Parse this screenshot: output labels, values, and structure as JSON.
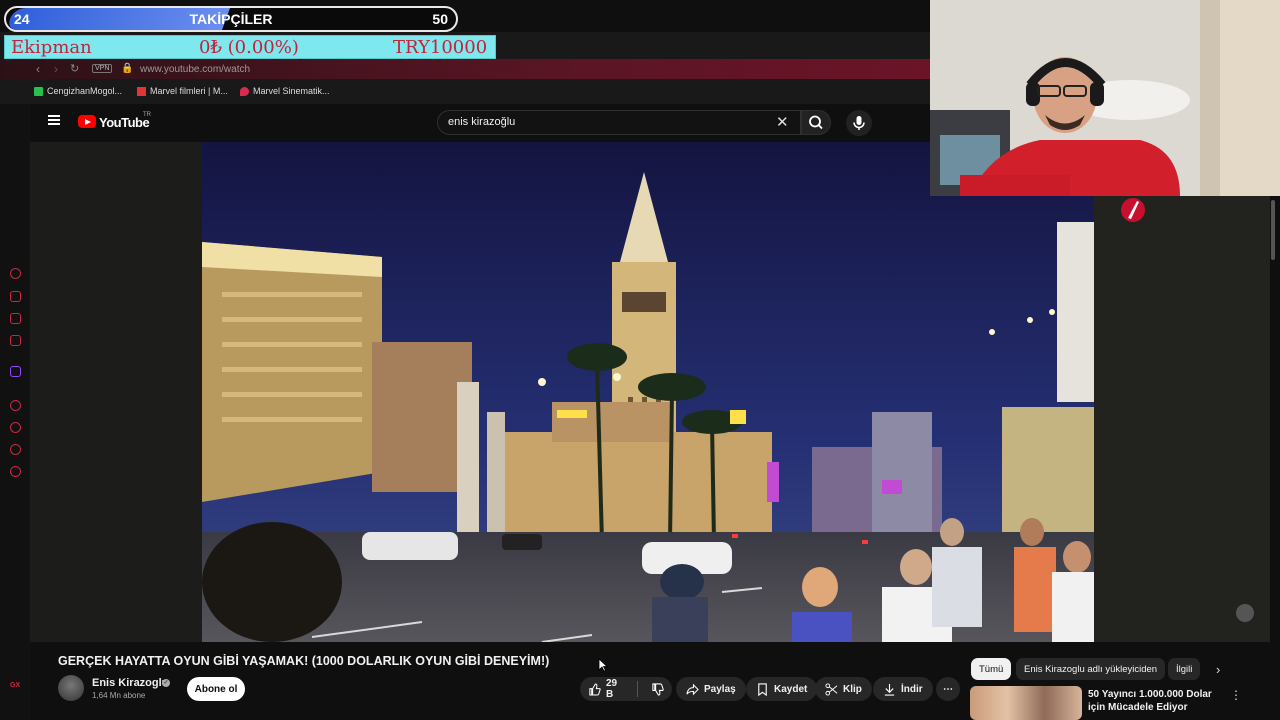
{
  "overlay": {
    "followers": {
      "current": "24",
      "title": "TAKİPÇİLER",
      "goal": "50",
      "progress_fraction": 0.48
    },
    "donation": {
      "label": "Ekipman",
      "amount": "0₺ (0.00%)",
      "goal": "TRY10000"
    }
  },
  "browser": {
    "vpn_label": "VPN",
    "url": "www.youtube.com/watch",
    "bookmarks": [
      {
        "label": "CengizhanMogol...",
        "icon": "green-k-icon"
      },
      {
        "label": "Marvel filmleri | M...",
        "icon": "marvel-icon"
      },
      {
        "label": "Marvel Sinematik...",
        "icon": "pin-icon"
      }
    ],
    "gx_label": "GX"
  },
  "youtube": {
    "logo_text": "YouTube",
    "region": "TR",
    "search_value": "enis kirazoğlu",
    "video": {
      "title": "GERÇEK HAYATTA OYUN GİBİ YAŞAMAK! (1000 DOLARLIK OYUN GİBİ DENEYİM!)",
      "channel": "Enis Kirazoglu",
      "subscribers": "1,64 Mn abone",
      "subscribe_label": "Abone ol",
      "likes": "29 B",
      "share_label": "Paylaş",
      "save_label": "Kaydet",
      "clip_label": "Klip",
      "download_label": "İndir"
    },
    "chips": [
      "Tümü",
      "Enis Kirazoglu adlı yükleyiciden",
      "İlgili"
    ],
    "recommended": {
      "title": "50 Yayıncı 1.000.000 Dolar için Mücadele Ediyor"
    }
  },
  "colors": {
    "accent": "#ff0000",
    "gx_red": "#d2243e",
    "overlay_blue": "#3f6be0",
    "donation_bg": "#7fe7ee"
  }
}
